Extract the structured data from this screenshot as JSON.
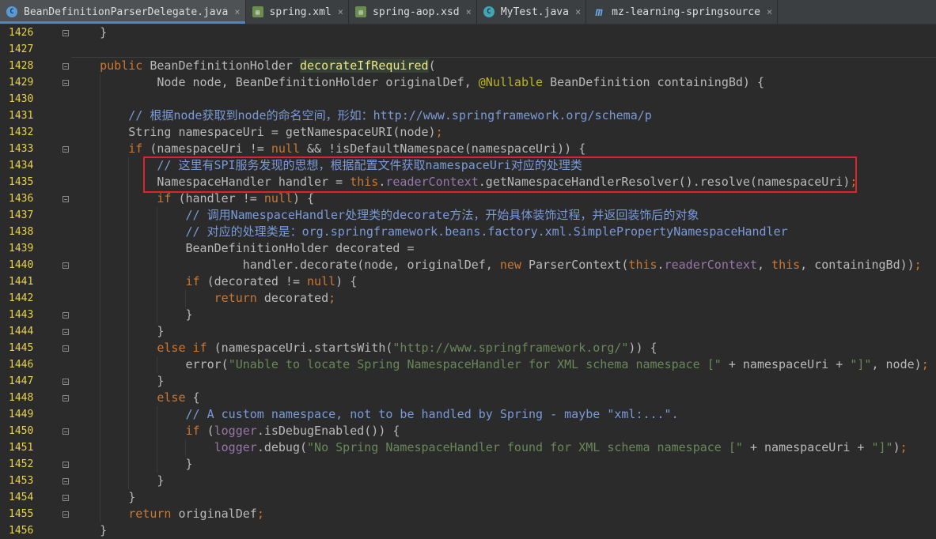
{
  "tabs": [
    {
      "label": "BeanDefinitionParserDelegate.java",
      "icon": "class-icon",
      "active": true
    },
    {
      "label": "spring.xml",
      "icon": "xml-file-icon",
      "active": false
    },
    {
      "label": "spring-aop.xsd",
      "icon": "xsd-file-icon",
      "active": false
    },
    {
      "label": "MyTest.java",
      "icon": "test-class-icon",
      "active": false
    },
    {
      "label": "mz-learning-springsource",
      "icon": "module-icon",
      "active": false
    }
  ],
  "tab_close_glyph": "×",
  "lines": [
    {
      "n": "1426",
      "tokens": [
        {
          "t": "    }",
          "c": "plain"
        }
      ]
    },
    {
      "n": "1427",
      "tokens": []
    },
    {
      "n": "1428",
      "tokens": [
        {
          "t": "    ",
          "c": "plain"
        },
        {
          "t": "public",
          "c": "kw"
        },
        {
          "t": " BeanDefinitionHolder ",
          "c": "plain"
        },
        {
          "t": "decorateIfRequired",
          "c": "hl"
        },
        {
          "t": "(",
          "c": "plain"
        }
      ]
    },
    {
      "n": "1429",
      "tokens": [
        {
          "t": "            Node node, BeanDefinitionHolder originalDef, ",
          "c": "plain"
        },
        {
          "t": "@Nullable",
          "c": "ann"
        },
        {
          "t": " BeanDefinition containingBd) {",
          "c": "plain"
        }
      ]
    },
    {
      "n": "1430",
      "tokens": []
    },
    {
      "n": "1431",
      "tokens": [
        {
          "t": "        ",
          "c": "plain"
        },
        {
          "t": "// 根据node获取到node的命名空间，形如：http://www.springframework.org/schema/p",
          "c": "cmx"
        }
      ]
    },
    {
      "n": "1432",
      "tokens": [
        {
          "t": "        String namespaceUri = getNamespaceURI(node)",
          "c": "plain"
        },
        {
          "t": ";",
          "c": "kw"
        }
      ]
    },
    {
      "n": "1433",
      "tokens": [
        {
          "t": "        ",
          "c": "plain"
        },
        {
          "t": "if",
          "c": "kw"
        },
        {
          "t": " (namespaceUri != ",
          "c": "plain"
        },
        {
          "t": "null",
          "c": "kw"
        },
        {
          "t": " && !isDefaultNamespace(namespaceUri)) {",
          "c": "plain"
        }
      ]
    },
    {
      "n": "1434",
      "tokens": [
        {
          "t": "            ",
          "c": "plain"
        },
        {
          "t": "// 这里有SPI服务发现的思想，根据配置文件获取namespaceUri对应的处理类",
          "c": "cmx"
        }
      ]
    },
    {
      "n": "1435",
      "tokens": [
        {
          "t": "            NamespaceHandler handler = ",
          "c": "plain"
        },
        {
          "t": "this",
          "c": "kw"
        },
        {
          "t": ".",
          "c": "plain"
        },
        {
          "t": "readerContext",
          "c": "fld"
        },
        {
          "t": ".getNamespaceHandlerResolver().resolve(namespaceUri)",
          "c": "plain"
        },
        {
          "t": ";",
          "c": "kw"
        }
      ]
    },
    {
      "n": "1436",
      "tokens": [
        {
          "t": "            ",
          "c": "plain"
        },
        {
          "t": "if",
          "c": "kw"
        },
        {
          "t": " (handler != ",
          "c": "plain"
        },
        {
          "t": "null",
          "c": "kw"
        },
        {
          "t": ") {",
          "c": "plain"
        }
      ]
    },
    {
      "n": "1437",
      "tokens": [
        {
          "t": "                ",
          "c": "plain"
        },
        {
          "t": "// 调用NamespaceHandler处理类的decorate方法，开始具体装饰过程，并返回装饰后的对象",
          "c": "cmx"
        }
      ]
    },
    {
      "n": "1438",
      "tokens": [
        {
          "t": "                ",
          "c": "plain"
        },
        {
          "t": "// 对应的处理类是：org.springframework.beans.factory.xml.SimplePropertyNamespaceHandler",
          "c": "cmx"
        }
      ]
    },
    {
      "n": "1439",
      "tokens": [
        {
          "t": "                BeanDefinitionHolder decorated =",
          "c": "plain"
        }
      ]
    },
    {
      "n": "1440",
      "tokens": [
        {
          "t": "                        handler.decorate(node, originalDef, ",
          "c": "plain"
        },
        {
          "t": "new",
          "c": "kw"
        },
        {
          "t": " ParserContext(",
          "c": "plain"
        },
        {
          "t": "this",
          "c": "kw"
        },
        {
          "t": ".",
          "c": "plain"
        },
        {
          "t": "readerContext",
          "c": "fld"
        },
        {
          "t": ", ",
          "c": "plain"
        },
        {
          "t": "this",
          "c": "kw"
        },
        {
          "t": ", containingBd))",
          "c": "plain"
        },
        {
          "t": ";",
          "c": "kw"
        }
      ]
    },
    {
      "n": "1441",
      "tokens": [
        {
          "t": "                ",
          "c": "plain"
        },
        {
          "t": "if",
          "c": "kw"
        },
        {
          "t": " (decorated != ",
          "c": "plain"
        },
        {
          "t": "null",
          "c": "kw"
        },
        {
          "t": ") {",
          "c": "plain"
        }
      ]
    },
    {
      "n": "1442",
      "tokens": [
        {
          "t": "                    ",
          "c": "plain"
        },
        {
          "t": "return",
          "c": "kw"
        },
        {
          "t": " decorated",
          "c": "plain"
        },
        {
          "t": ";",
          "c": "kw"
        }
      ]
    },
    {
      "n": "1443",
      "tokens": [
        {
          "t": "                }",
          "c": "plain"
        }
      ]
    },
    {
      "n": "1444",
      "tokens": [
        {
          "t": "            }",
          "c": "plain"
        }
      ]
    },
    {
      "n": "1445",
      "tokens": [
        {
          "t": "            ",
          "c": "plain"
        },
        {
          "t": "else if",
          "c": "kw"
        },
        {
          "t": " (namespaceUri.startsWith(",
          "c": "plain"
        },
        {
          "t": "\"http://www.springframework.org/\"",
          "c": "str"
        },
        {
          "t": ")) {",
          "c": "plain"
        }
      ]
    },
    {
      "n": "1446",
      "tokens": [
        {
          "t": "                error(",
          "c": "plain"
        },
        {
          "t": "\"Unable to locate Spring NamespaceHandler for XML schema namespace [\"",
          "c": "str"
        },
        {
          "t": " + namespaceUri + ",
          "c": "plain"
        },
        {
          "t": "\"]\"",
          "c": "str"
        },
        {
          "t": ", node)",
          "c": "plain"
        },
        {
          "t": ";",
          "c": "kw"
        }
      ]
    },
    {
      "n": "1447",
      "tokens": [
        {
          "t": "            }",
          "c": "plain"
        }
      ]
    },
    {
      "n": "1448",
      "tokens": [
        {
          "t": "            ",
          "c": "plain"
        },
        {
          "t": "else",
          "c": "kw"
        },
        {
          "t": " {",
          "c": "plain"
        }
      ]
    },
    {
      "n": "1449",
      "tokens": [
        {
          "t": "                ",
          "c": "plain"
        },
        {
          "t": "// A custom namespace, not to be handled by Spring - maybe \"xml:...\".",
          "c": "cmx"
        }
      ]
    },
    {
      "n": "1450",
      "tokens": [
        {
          "t": "                ",
          "c": "plain"
        },
        {
          "t": "if",
          "c": "kw"
        },
        {
          "t": " (",
          "c": "plain"
        },
        {
          "t": "logger",
          "c": "fld"
        },
        {
          "t": ".isDebugEnabled()) {",
          "c": "plain"
        }
      ]
    },
    {
      "n": "1451",
      "tokens": [
        {
          "t": "                    ",
          "c": "plain"
        },
        {
          "t": "logger",
          "c": "fld"
        },
        {
          "t": ".debug(",
          "c": "plain"
        },
        {
          "t": "\"No Spring NamespaceHandler found for XML schema namespace [\"",
          "c": "str"
        },
        {
          "t": " + namespaceUri + ",
          "c": "plain"
        },
        {
          "t": "\"]\"",
          "c": "str"
        },
        {
          "t": ")",
          "c": "plain"
        },
        {
          "t": ";",
          "c": "kw"
        }
      ]
    },
    {
      "n": "1452",
      "tokens": [
        {
          "t": "                }",
          "c": "plain"
        }
      ]
    },
    {
      "n": "1453",
      "tokens": [
        {
          "t": "            }",
          "c": "plain"
        }
      ]
    },
    {
      "n": "1454",
      "tokens": [
        {
          "t": "        }",
          "c": "plain"
        }
      ]
    },
    {
      "n": "1455",
      "tokens": [
        {
          "t": "        ",
          "c": "plain"
        },
        {
          "t": "return",
          "c": "kw"
        },
        {
          "t": " originalDef",
          "c": "plain"
        },
        {
          "t": ";",
          "c": "kw"
        }
      ]
    },
    {
      "n": "1456",
      "tokens": [
        {
          "t": "    }",
          "c": "plain"
        }
      ]
    }
  ]
}
